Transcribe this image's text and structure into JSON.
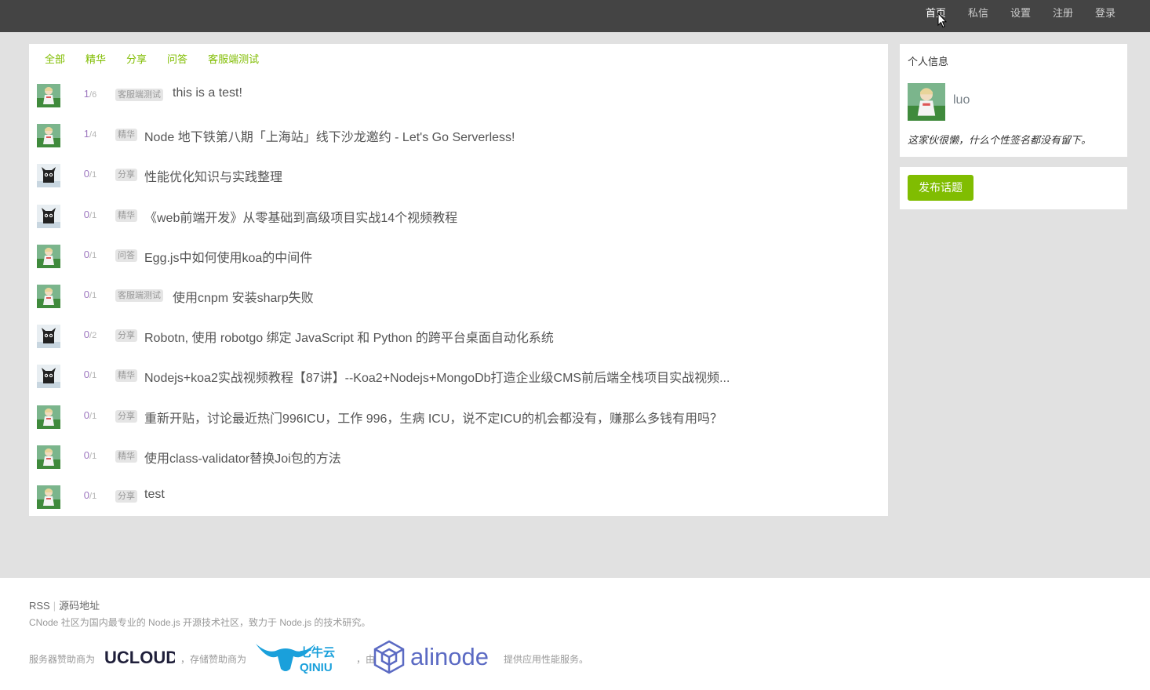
{
  "nav": {
    "items": [
      {
        "label": "首页",
        "active": true
      },
      {
        "label": "私信",
        "active": false
      },
      {
        "label": "设置",
        "active": false
      },
      {
        "label": "注册",
        "active": false
      },
      {
        "label": "登录",
        "active": false
      }
    ]
  },
  "tabs": [
    "全部",
    "精华",
    "分享",
    "问答",
    "客服端测试"
  ],
  "topics": [
    {
      "avatar": "girl-avatar",
      "replies": "1",
      "views": "6",
      "tag": "客服端测试",
      "title": "this is a test!"
    },
    {
      "avatar": "girl-avatar",
      "replies": "1",
      "views": "4",
      "tag": "精华",
      "title": "Node 地下铁第八期「上海站」线下沙龙邀约 - Let's Go Serverless!"
    },
    {
      "avatar": "cat-avatar",
      "replies": "0",
      "views": "1",
      "tag": "分享",
      "title": "性能优化知识与实践整理"
    },
    {
      "avatar": "cat-avatar",
      "replies": "0",
      "views": "1",
      "tag": "精华",
      "title": "《web前端开发》从零基础到高级项目实战14个视频教程"
    },
    {
      "avatar": "girl-avatar",
      "replies": "0",
      "views": "1",
      "tag": "问答",
      "title": "Egg.js中如何使用koa的中间件"
    },
    {
      "avatar": "girl-avatar",
      "replies": "0",
      "views": "1",
      "tag": "客服端测试",
      "title": "使用cnpm 安装sharp失败"
    },
    {
      "avatar": "cat-avatar",
      "replies": "0",
      "views": "2",
      "tag": "分享",
      "title": "Robotn, 使用 robotgo 绑定 JavaScript 和 Python 的跨平台桌面自动化系统"
    },
    {
      "avatar": "cat-avatar",
      "replies": "0",
      "views": "1",
      "tag": "精华",
      "title": "Nodejs+koa2实战视频教程【87讲】--Koa2+Nodejs+MongoDb打造企业级CMS前后端全栈项目实战视频..."
    },
    {
      "avatar": "girl-avatar",
      "replies": "0",
      "views": "1",
      "tag": "分享",
      "title": "重新开贴，讨论最近热门996ICU，工作 996，生病 ICU，说不定ICU的机会都没有，赚那么多钱有用吗？"
    },
    {
      "avatar": "girl-avatar",
      "replies": "0",
      "views": "1",
      "tag": "精华",
      "title": "使用class-validator替换Joi包的方法"
    },
    {
      "avatar": "girl-avatar",
      "replies": "0",
      "views": "1",
      "tag": "分享",
      "title": "test"
    }
  ],
  "sidebar": {
    "profile_header": "个人信息",
    "username": "luo",
    "signature": "这家伙很懒，什么个性签名都没有留下。",
    "publish_button": "发布话题"
  },
  "footer": {
    "rss": "RSS",
    "source": "源码地址",
    "description": "CNode 社区为国内最专业的 Node.js 开源技术社区，致力于 Node.js 的技术研究。",
    "sponsor_server": "服务器赞助商为",
    "ucloud_logo": "UCLOUD",
    "sponsor_storage": "，存储赞助商为",
    "qiniu_logo": "七牛云",
    "qiniu_logo_en": "QINIU",
    "by": "，由",
    "alinode_logo": "alinode",
    "perf_service": "提供应用性能服务。"
  },
  "colors": {
    "accent": "#80bd01",
    "navbar": "#444444",
    "reply_count": "#9e78c0"
  }
}
